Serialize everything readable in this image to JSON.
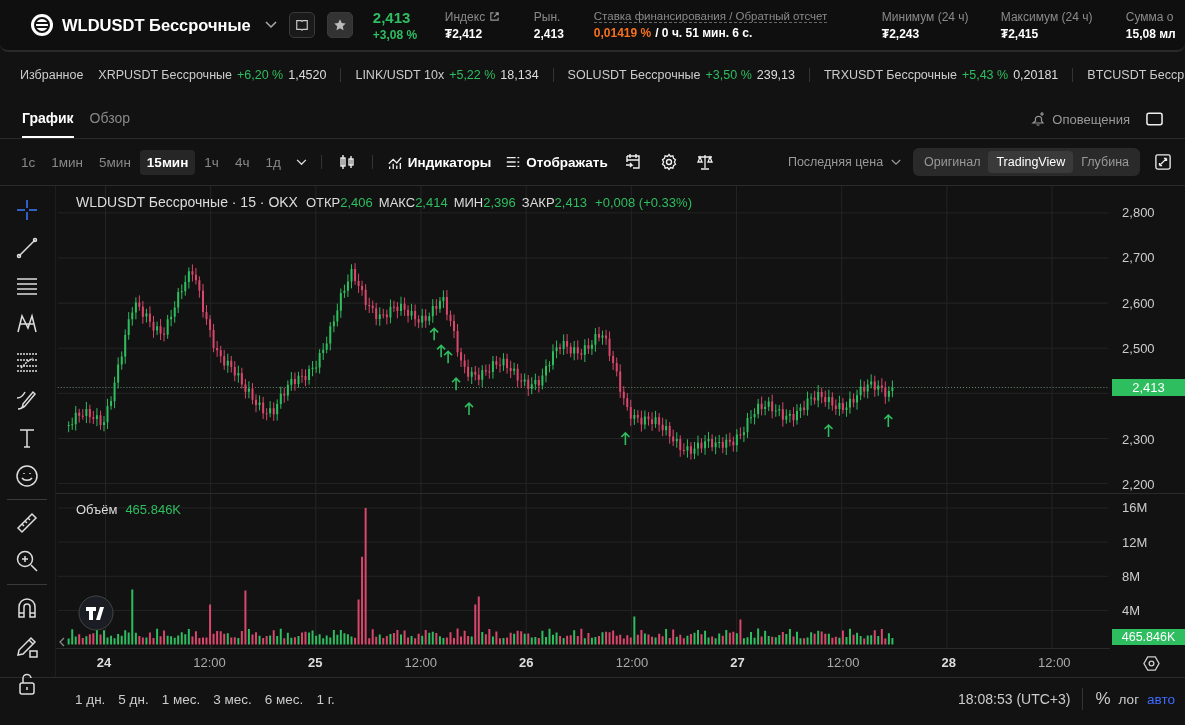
{
  "header": {
    "symbol": "WLDUSDT Бессрочные",
    "price": "2,413",
    "change": "+3,08 %",
    "stats": [
      {
        "label": "Индекс",
        "value": "₮2,412",
        "kind": "link"
      },
      {
        "label": "Рын.",
        "value": "2,413",
        "kind": "plain"
      },
      {
        "label": "Ставка финансирования / Обратный отсчет",
        "value": "0,01419 %",
        "countdown": "/ 0 ч. 51 мин. 6 с.",
        "kind": "funding"
      },
      {
        "label": "Минимум (24 ч)",
        "value": "₮2,243",
        "kind": "plain"
      },
      {
        "label": "Максимум (24 ч)",
        "value": "₮2,415",
        "kind": "plain"
      },
      {
        "label": "Сумма о",
        "value": "15,08 мл",
        "kind": "plain"
      }
    ]
  },
  "ticker": {
    "favorites": "Избранное",
    "items": [
      {
        "name": "XRPUSDT Бессрочные",
        "change": "+6,20 %",
        "price": "1,4520"
      },
      {
        "name": "LINK/USDT 10x",
        "change": "+5,22 %",
        "price": "18,134"
      },
      {
        "name": "SOLUSDT Бессрочные",
        "change": "+3,50 %",
        "price": "239,13"
      },
      {
        "name": "TRXUSDT Бессрочные",
        "change": "+5,43 %",
        "price": "0,20181"
      },
      {
        "name": "BTCUSDT Бесср"
      }
    ]
  },
  "tabs": [
    {
      "label": "График",
      "selected": true
    },
    {
      "label": "Обзор",
      "selected": false
    }
  ],
  "alerts": "Оповещения",
  "intervals": [
    {
      "label": "1с",
      "selected": false
    },
    {
      "label": "1мин",
      "selected": false
    },
    {
      "label": "5мин",
      "selected": false
    },
    {
      "label": "15мин",
      "selected": true
    },
    {
      "label": "1ч",
      "selected": false
    },
    {
      "label": "4ч",
      "selected": false
    },
    {
      "label": "1д",
      "selected": false
    }
  ],
  "indicators": "Индикаторы",
  "display": "Отображать",
  "price_type": "Последняя цена",
  "views": [
    {
      "label": "Оригинал",
      "selected": false
    },
    {
      "label": "TradingView",
      "selected": true
    },
    {
      "label": "Глубина",
      "selected": false
    }
  ],
  "tools": [
    {
      "kind": "crosshair",
      "selected": true
    },
    {
      "kind": "line",
      "selected": false
    },
    {
      "kind": "hlines",
      "selected": false
    },
    {
      "kind": "pattern",
      "selected": false
    },
    {
      "kind": "fib",
      "selected": false
    },
    {
      "kind": "brush",
      "selected": false
    },
    {
      "kind": "text",
      "selected": false
    },
    {
      "kind": "emoji",
      "selected": false
    },
    {
      "kind": "ruler",
      "selected": false
    },
    {
      "kind": "zoom",
      "selected": false
    },
    {
      "kind": "magnet",
      "selected": false
    },
    {
      "kind": "pencil-lock",
      "selected": false
    },
    {
      "kind": "lock",
      "selected": false
    }
  ],
  "legend": {
    "title": "WLDUSDT Бессрочные · 15 · OKX",
    "ohlc": [
      {
        "label": "ОТКР",
        "value": "2,406"
      },
      {
        "label": "МАКС",
        "value": "2,414"
      },
      {
        "label": "МИН",
        "value": "2,396"
      },
      {
        "label": "ЗАКР",
        "value": "2,413"
      }
    ],
    "change": "+0,008 (+0.33%)"
  },
  "price_axis": {
    "ticks": [
      "2,800",
      "2,700",
      "2,600",
      "2,500",
      "2,300",
      "2,200"
    ],
    "current": "2,413"
  },
  "volume": {
    "label": "Объём",
    "value": "465.846K",
    "ticks": [
      "16M",
      "12M",
      "8M",
      "4M"
    ],
    "current": "465.846K"
  },
  "time_axis": [
    {
      "label": "24",
      "kind": "day"
    },
    {
      "label": "12:00",
      "kind": "time"
    },
    {
      "label": "25",
      "kind": "day"
    },
    {
      "label": "12:00",
      "kind": "time"
    },
    {
      "label": "26",
      "kind": "day"
    },
    {
      "label": "12:00",
      "kind": "time"
    },
    {
      "label": "27",
      "kind": "day"
    },
    {
      "label": "12:00",
      "kind": "time"
    },
    {
      "label": "28",
      "kind": "day"
    },
    {
      "label": "12:00",
      "kind": "time"
    }
  ],
  "ranges": [
    "1 дн.",
    "5 дн.",
    "1 мес.",
    "3 мес.",
    "6 мес.",
    "1 г."
  ],
  "clock": "18:08:53 (UTC+3)",
  "scale_buttons": [
    {
      "label": "%",
      "selected": false
    },
    {
      "label": "лог",
      "selected": false
    },
    {
      "label": "авто",
      "selected": true
    }
  ]
}
